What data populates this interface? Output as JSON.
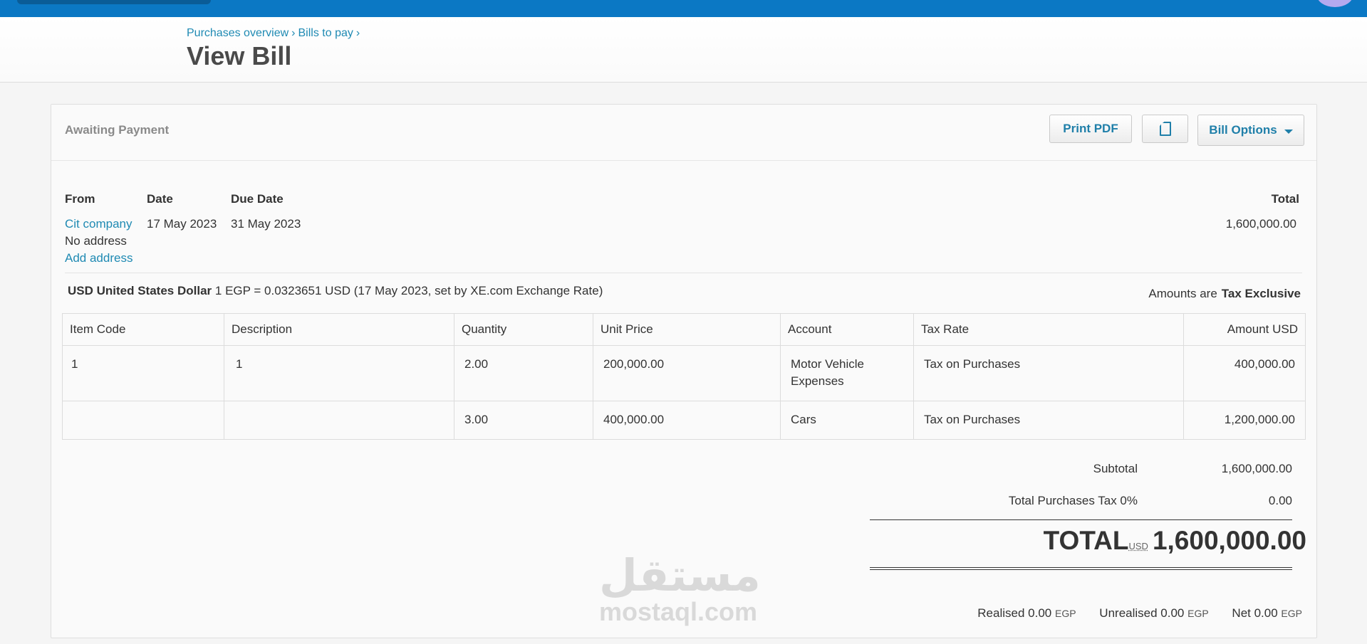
{
  "breadcrumb": {
    "items": [
      "Purchases overview",
      "Bills to pay"
    ],
    "separator": "›"
  },
  "page_title": "View Bill",
  "status": "Awaiting Payment",
  "actions": {
    "print_pdf": "Print PDF",
    "copy_icon": "copy-icon",
    "bill_options": "Bill Options"
  },
  "info": {
    "from_label": "From",
    "date_label": "Date",
    "due_date_label": "Due Date",
    "total_label": "Total",
    "from_name": "Cit company",
    "no_address": "No address",
    "add_address": "Add address",
    "date": "17 May 2023",
    "due_date": "31 May 2023",
    "total": "1,600,000.00"
  },
  "currency": {
    "code_name": "USD United States Dollar",
    "rate": "1 EGP = 0.0323651 USD (17 May 2023, set by XE.com Exchange Rate)"
  },
  "amounts_are": {
    "label": "Amounts are",
    "value": "Tax Exclusive"
  },
  "table": {
    "headers": [
      "Item Code",
      "Description",
      "Quantity",
      "Unit Price",
      "Account",
      "Tax Rate",
      "Amount USD"
    ],
    "rows": [
      [
        "1",
        "1",
        "2.00",
        "200,000.00",
        "Motor Vehicle Expenses",
        "Tax on Purchases",
        "400,000.00"
      ],
      [
        "",
        "",
        "3.00",
        "400,000.00",
        "Cars",
        "Tax on Purchases",
        "1,200,000.00"
      ]
    ]
  },
  "summary": {
    "subtotal_label": "Subtotal",
    "subtotal": "1,600,000.00",
    "tax_label": "Total Purchases Tax 0%",
    "tax": "0.00",
    "total_word": "TOTAL",
    "total_currency": "USD",
    "total": "1,600,000.00"
  },
  "footer": {
    "realised_label": "Realised 0.00",
    "unrealised_label": "Unrealised 0.00",
    "net_label": "Net 0.00",
    "currency": "EGP"
  },
  "watermark": {
    "arabic": "مستقل",
    "latin": "mostaql.com"
  },
  "colors": {
    "topbar": "#0b78c4",
    "link": "#1f8ab3",
    "button_text": "#1f7fa9"
  }
}
